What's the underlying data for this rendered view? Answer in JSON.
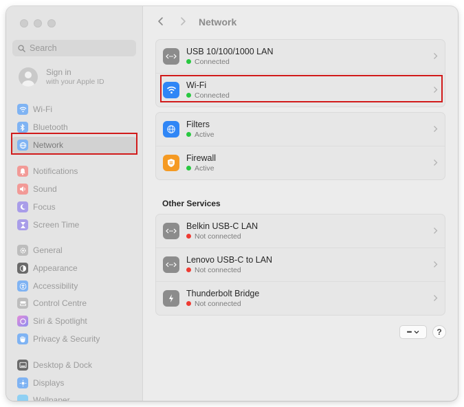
{
  "window": {
    "title": "Network"
  },
  "sidebar": {
    "search_placeholder": "Search",
    "signin": {
      "title": "Sign in",
      "subtitle": "with your Apple ID"
    },
    "items": [
      {
        "label": "Wi-Fi",
        "icon": "wifi-icon",
        "color": "#3d8ff5"
      },
      {
        "label": "Bluetooth",
        "icon": "bluetooth-icon",
        "color": "#3d8ff5"
      },
      {
        "label": "Network",
        "icon": "globe-icon",
        "color": "#3d8ff5",
        "selected": true
      },
      {
        "label": "Notifications",
        "icon": "bell-icon",
        "color": "#f0544f"
      },
      {
        "label": "Sound",
        "icon": "speaker-icon",
        "color": "#f0544f"
      },
      {
        "label": "Focus",
        "icon": "moon-icon",
        "color": "#6e5ee0"
      },
      {
        "label": "Screen Time",
        "icon": "hourglass-icon",
        "color": "#6e5ee0"
      },
      {
        "label": "General",
        "icon": "gear-icon",
        "color": "#9a9a9a"
      },
      {
        "label": "Appearance",
        "icon": "appearance-icon",
        "color": "#2a2a2a"
      },
      {
        "label": "Accessibility",
        "icon": "accessibility-icon",
        "color": "#3d8ff5"
      },
      {
        "label": "Control Centre",
        "icon": "control-centre-icon",
        "color": "#9a9a9a"
      },
      {
        "label": "Siri & Spotlight",
        "icon": "siri-icon",
        "color": "#c159d9"
      },
      {
        "label": "Privacy & Security",
        "icon": "hand-icon",
        "color": "#3d8ff5"
      },
      {
        "label": "Desktop & Dock",
        "icon": "dock-icon",
        "color": "#2a2a2a"
      },
      {
        "label": "Displays",
        "icon": "sun-icon",
        "color": "#3d8ff5"
      },
      {
        "label": "Wallpaper",
        "icon": "wallpaper-icon",
        "color": "#3db3f0"
      }
    ]
  },
  "services": [
    {
      "name": "USB 10/100/1000 LAN",
      "status": "Connected",
      "status_color": "#28c840",
      "icon": "ethernet-icon"
    },
    {
      "name": "Wi-Fi",
      "status": "Connected",
      "status_color": "#28c840",
      "icon": "wifi-icon"
    }
  ],
  "security": [
    {
      "name": "Filters",
      "status": "Active",
      "status_color": "#28c840",
      "icon": "filters-icon"
    },
    {
      "name": "Firewall",
      "status": "Active",
      "status_color": "#28c840",
      "icon": "firewall-icon"
    }
  ],
  "other_services": {
    "title": "Other Services",
    "items": [
      {
        "name": "Belkin USB-C LAN",
        "status": "Not connected",
        "status_color": "#ee3b33",
        "icon": "ethernet-icon"
      },
      {
        "name": "Lenovo USB-C to LAN",
        "status": "Not connected",
        "status_color": "#ee3b33",
        "icon": "ethernet-icon"
      },
      {
        "name": "Thunderbolt Bridge",
        "status": "Not connected",
        "status_color": "#ee3b33",
        "icon": "thunderbolt-icon"
      }
    ]
  },
  "footer": {
    "more_label": "•••",
    "help_label": "?"
  },
  "colors": {
    "highlight": "#d11a1a",
    "accent": "#3d8ff5"
  }
}
